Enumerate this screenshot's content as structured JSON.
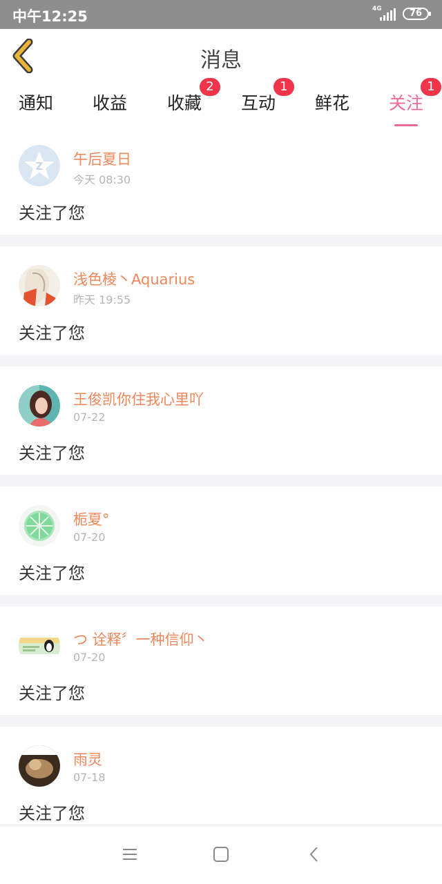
{
  "status_bar": {
    "time": "中午12:25",
    "network": "4G",
    "battery": "76"
  },
  "header": {
    "title": "消息"
  },
  "tabs": [
    {
      "label": "通知",
      "badge": ""
    },
    {
      "label": "收益",
      "badge": ""
    },
    {
      "label": "收藏",
      "badge": "2"
    },
    {
      "label": "互动",
      "badge": "1"
    },
    {
      "label": "鲜花",
      "badge": ""
    },
    {
      "label": "关注",
      "badge": "1"
    }
  ],
  "active_tab": "关注",
  "colors": {
    "accent": "#ee6a98",
    "name": "#f0875a",
    "badge": "#f0344a",
    "back_icon": "#e9b43a"
  },
  "items": [
    {
      "name": "午后夏日",
      "date": "今天 08:30",
      "message": "关注了您"
    },
    {
      "name": "浅色棱丶Aquarius",
      "date": "昨天 19:55",
      "message": "关注了您"
    },
    {
      "name": "王俊凯你住我心里吖",
      "date": "07-22",
      "message": "关注了您"
    },
    {
      "name": "栀夏°",
      "date": "07-20",
      "message": "关注了您"
    },
    {
      "name": "つ 诠释〞一种信仰丶",
      "date": "07-20",
      "message": "关注了您"
    },
    {
      "name": "雨灵",
      "date": "07-18",
      "message": "关注了您"
    }
  ],
  "nav_icons": [
    "menu-icon",
    "home-square-icon",
    "back-chevron-icon"
  ]
}
